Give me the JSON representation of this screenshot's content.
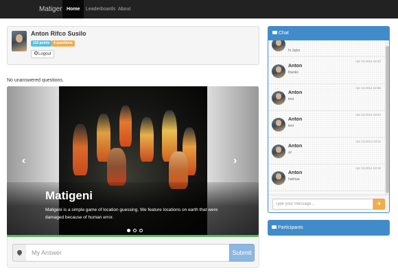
{
  "navbar": {
    "brand": "Matigeni",
    "items": [
      {
        "label": "Home",
        "active": true
      },
      {
        "label": "Leaderboards",
        "active": false
      },
      {
        "label": "About",
        "active": false
      }
    ],
    "background": "#222222"
  },
  "profile": {
    "name": "Anton Rifco Susilo",
    "points_badge": "110 points",
    "questions_badge": "4 questions",
    "logout_label": "Logout",
    "logout_icon": "power-icon"
  },
  "status_text": "No unanswered questions.",
  "carousel": {
    "caption_title": "Matigeni",
    "caption_text": "Matigeni is a simple game of location guessing. We feature locations on earth that were damaged because of human error.",
    "prev_icon": "chevron-left-icon",
    "next_icon": "chevron-right-icon",
    "prev_glyph": "‹",
    "next_glyph": "›",
    "indicators": [
      true,
      false,
      false
    ]
  },
  "answer_form": {
    "placeholder": "My Answer",
    "value": "",
    "submit_label": "Submit",
    "icon": "map-marker-icon"
  },
  "chat": {
    "title": "Chat",
    "title_icon": "comment-icon",
    "messages": [
      {
        "name": "",
        "time": "",
        "text": "hi Jojoo"
      },
      {
        "name": "Anton",
        "time": "Apr 13,2014 22:23",
        "text": "thanks"
      },
      {
        "name": "Anton",
        "time": "Apr 13,2014 22:56",
        "text": "test"
      },
      {
        "name": "Anton",
        "time": "Apr 13,2014 23:04",
        "text": "test"
      },
      {
        "name": "Anton",
        "time": "Apr 13,2014 23:11",
        "text": "zz"
      },
      {
        "name": "Anton",
        "time": "Apr 13,2014 23:16",
        "text": "hahhaa"
      }
    ],
    "input_placeholder": "Type your message...",
    "send_icon": "send-icon",
    "send_glyph": "✈"
  },
  "participants": {
    "title": "Participants",
    "title_icon": "comment-icon"
  },
  "colors": {
    "primary": "#428bca",
    "info": "#5bc0de",
    "warning": "#f0ad4e",
    "success": "#5cb85c",
    "submit": "#8cb8e0"
  }
}
